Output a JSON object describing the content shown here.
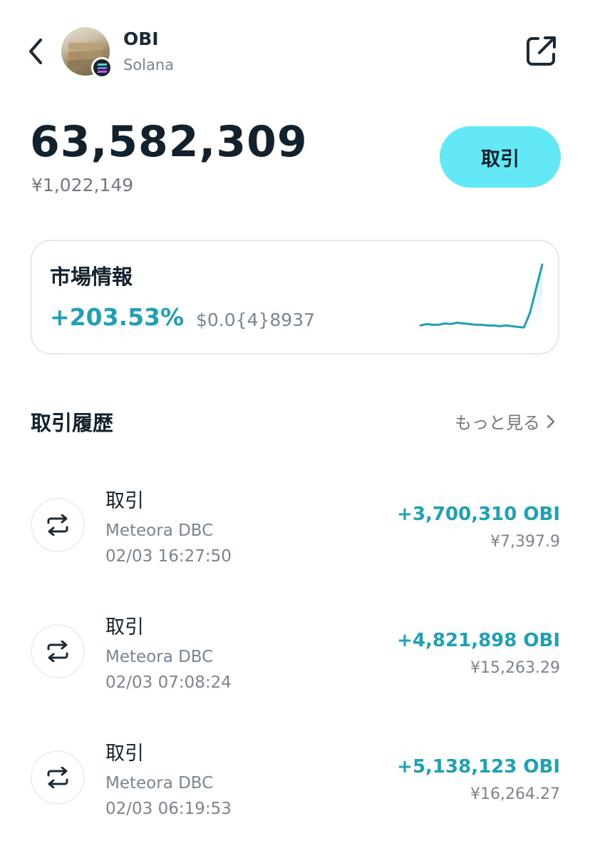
{
  "header": {
    "back_icon": "chevron-left-icon",
    "token_name": "OBI",
    "chain_name": "Solana",
    "share_icon": "share-icon"
  },
  "balance": {
    "amount": "63,582,309",
    "fiat": "¥1,022,149",
    "trade_label": "取引"
  },
  "market": {
    "title": "市場情報",
    "change": "+203.53%",
    "price": "$0.0{4}8937",
    "sparkline": [
      0.06,
      0.08,
      0.07,
      0.07,
      0.09,
      0.08,
      0.1,
      0.09,
      0.08,
      0.07,
      0.07,
      0.06,
      0.06,
      0.05,
      0.06,
      0.05,
      0.04,
      0.03,
      0.25,
      0.6,
      0.95
    ],
    "accent_color": "#1fa0b4"
  },
  "history": {
    "title": "取引履歴",
    "more_label": "もっと見る",
    "items": [
      {
        "title": "取引",
        "source": "Meteora DBC",
        "time": "02/03 16:27:50",
        "amount": "+3,700,310 OBI",
        "fiat": "¥7,397.9"
      },
      {
        "title": "取引",
        "source": "Meteora DBC",
        "time": "02/03 07:08:24",
        "amount": "+4,821,898 OBI",
        "fiat": "¥15,263.29"
      },
      {
        "title": "取引",
        "source": "Meteora DBC",
        "time": "02/03 06:19:53",
        "amount": "+5,138,123 OBI",
        "fiat": "¥16,264.27"
      }
    ]
  },
  "colors": {
    "trade_button": "#63e8f5",
    "positive": "#1fa0b4"
  }
}
